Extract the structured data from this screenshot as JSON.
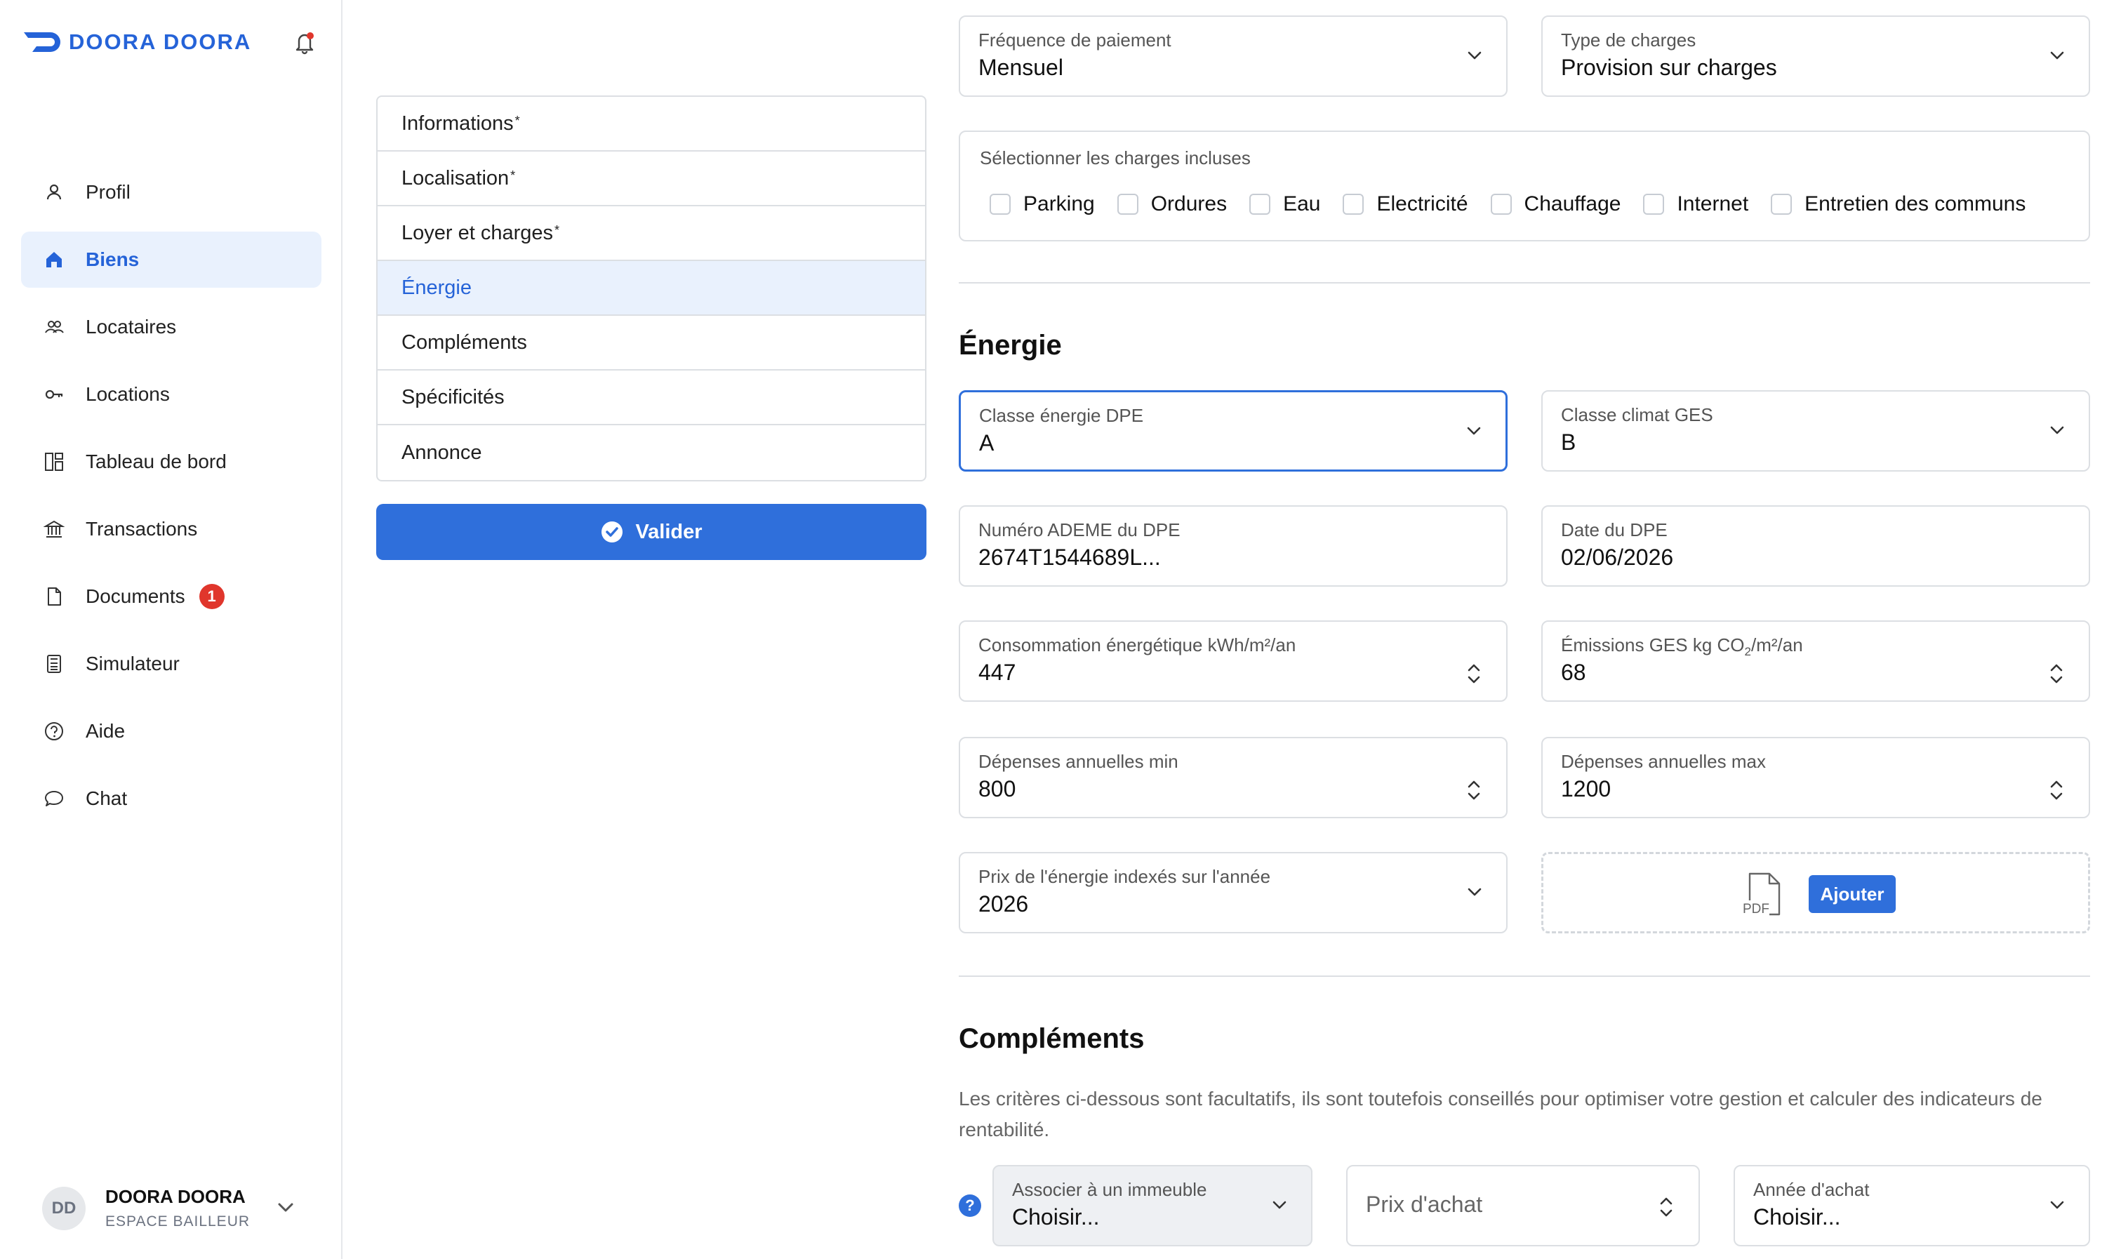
{
  "brand": {
    "name": "DOORA DOORA"
  },
  "sidebar": {
    "items": [
      {
        "label": "Profil",
        "icon": "user-icon"
      },
      {
        "label": "Biens",
        "icon": "home-icon",
        "active": true
      },
      {
        "label": "Locataires",
        "icon": "users-icon"
      },
      {
        "label": "Locations",
        "icon": "key-icon"
      },
      {
        "label": "Tableau de bord",
        "icon": "dashboard-icon"
      },
      {
        "label": "Transactions",
        "icon": "bank-icon"
      },
      {
        "label": "Documents",
        "icon": "document-icon",
        "badge": "1"
      },
      {
        "label": "Simulateur",
        "icon": "calculator-icon"
      },
      {
        "label": "Aide",
        "icon": "help-icon"
      },
      {
        "label": "Chat",
        "icon": "chat-icon"
      }
    ]
  },
  "user": {
    "initials": "DD",
    "name": "DOORA DOORA",
    "role": "ESPACE BAILLEUR"
  },
  "menu": {
    "items": [
      {
        "label": "Informations",
        "required": "*"
      },
      {
        "label": "Localisation",
        "required": "*"
      },
      {
        "label": "Loyer et charges",
        "required": "*"
      },
      {
        "label": "Énergie",
        "active": true
      },
      {
        "label": "Compléments"
      },
      {
        "label": "Spécificités"
      },
      {
        "label": "Annonce"
      }
    ],
    "validate_label": "Valider"
  },
  "loyer": {
    "frequence": {
      "label": "Fréquence de paiement",
      "value": "Mensuel"
    },
    "type_charges": {
      "label": "Type de charges",
      "value": "Provision sur charges"
    },
    "charges_incluses": {
      "title": "Sélectionner les charges incluses",
      "options": [
        "Parking",
        "Ordures",
        "Eau",
        "Electricité",
        "Chauffage",
        "Internet",
        "Entretien des communs"
      ]
    }
  },
  "energie": {
    "heading": "Énergie",
    "dpe_class": {
      "label": "Classe énergie DPE",
      "value": "A"
    },
    "ges_class": {
      "label": "Classe climat GES",
      "value": "B"
    },
    "ademe": {
      "label": "Numéro ADEME du DPE",
      "value": "2674T1544689L..."
    },
    "dpe_date": {
      "label": "Date du DPE",
      "value": "02/06/2026"
    },
    "conso": {
      "label": "Consommation énergétique kWh/m²/an",
      "value": "447"
    },
    "emissions": {
      "label_pre": "Émissions GES kg CO",
      "label_sub": "2",
      "label_post": "/m²/an",
      "value": "68"
    },
    "dep_min": {
      "label": "Dépenses annuelles min",
      "value": "800"
    },
    "dep_max": {
      "label": "Dépenses annuelles max",
      "value": "1200"
    },
    "prix_annee": {
      "label": "Prix de l'énergie indexés sur l'année",
      "value": "2026"
    },
    "upload": {
      "pdf_label": "PDF",
      "add_label": "Ajouter"
    }
  },
  "complements": {
    "heading": "Compléments",
    "description": "Les critères ci-dessous sont facultatifs, ils sont toutefois conseillés pour optimiser votre gestion et calculer des indicateurs de rentabilité.",
    "help": "?",
    "immeuble": {
      "label": "Associer à un immeuble",
      "value": "Choisir..."
    },
    "prix_achat": {
      "placeholder": "Prix d'achat"
    },
    "annee_achat": {
      "label": "Année d'achat",
      "value": "Choisir..."
    }
  },
  "colors": {
    "accent": "#2f6fdb",
    "active_bg": "#e9f1fd",
    "badge": "#e0362c",
    "border": "#dcdfe3"
  }
}
